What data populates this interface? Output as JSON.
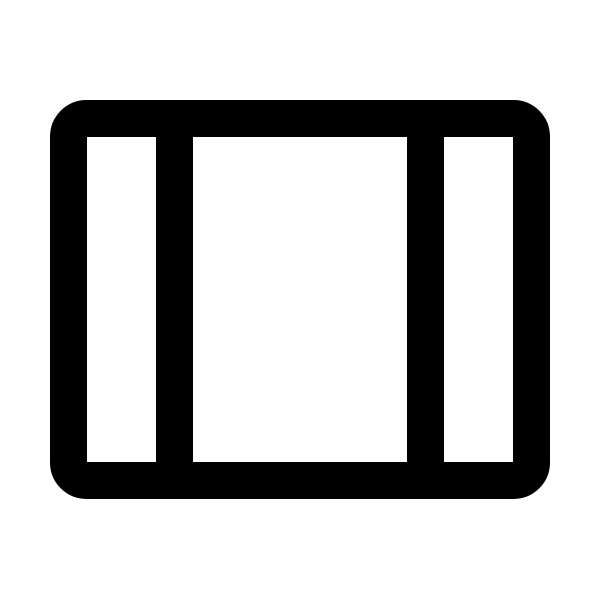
{
  "icon": {
    "name": "three-column-layout-icon",
    "stroke_color": "#000000",
    "background_color": "#ffffff"
  }
}
